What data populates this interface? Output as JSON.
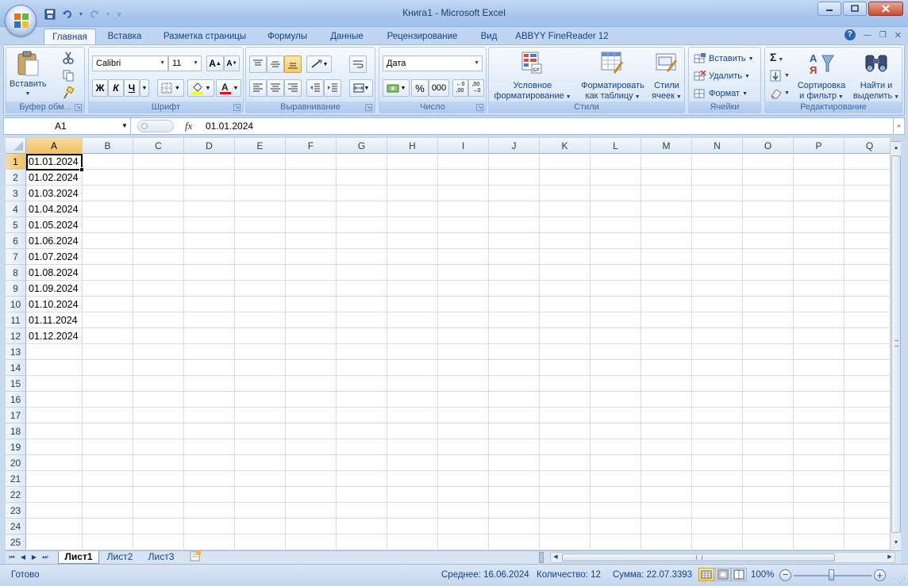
{
  "window": {
    "title": "Книга1 - Microsoft Excel"
  },
  "tabs": [
    "Главная",
    "Вставка",
    "Разметка страницы",
    "Формулы",
    "Данные",
    "Рецензирование",
    "Вид",
    "ABBYY FineReader 12"
  ],
  "ribbon": {
    "clipboard": {
      "paste": "Вставить",
      "label": "Буфер обм..."
    },
    "font": {
      "name": "Calibri",
      "size": "11",
      "bold": "Ж",
      "italic": "К",
      "underline": "Ч",
      "label": "Шрифт"
    },
    "alignment": {
      "label": "Выравнивание"
    },
    "number": {
      "format": "Дата",
      "percent": "%",
      "thousands": "000",
      "label": "Число"
    },
    "styles": {
      "conditional_1": "Условное",
      "conditional_2": "форматирование",
      "table_1": "Форматировать",
      "table_2": "как таблицу",
      "cell_1": "Стили",
      "cell_2": "ячеек",
      "label": "Стили"
    },
    "cells": {
      "insert": "Вставить",
      "delete": "Удалить",
      "format": "Формат",
      "label": "Ячейки"
    },
    "editing": {
      "sort_1": "Сортировка",
      "sort_2": "и фильтр",
      "find_1": "Найти и",
      "find_2": "выделить",
      "label": "Редактирование"
    }
  },
  "formula_bar": {
    "name_box": "A1",
    "fx": "fx",
    "value": "01.01.2024"
  },
  "columns": [
    "A",
    "B",
    "C",
    "D",
    "E",
    "F",
    "G",
    "H",
    "I",
    "J",
    "K",
    "L",
    "M",
    "N",
    "O",
    "P",
    "Q"
  ],
  "rows": [
    "1",
    "2",
    "3",
    "4",
    "5",
    "6",
    "7",
    "8",
    "9",
    "10",
    "11",
    "12",
    "13",
    "14",
    "15",
    "16",
    "17",
    "18",
    "19",
    "20",
    "21",
    "22",
    "23",
    "24",
    "25"
  ],
  "cells_a": [
    "01.01.2024",
    "01.02.2024",
    "01.03.2024",
    "01.04.2024",
    "01.05.2024",
    "01.06.2024",
    "01.07.2024",
    "01.08.2024",
    "01.09.2024",
    "01.10.2024",
    "01.11.2024",
    "01.12.2024"
  ],
  "sheets": [
    "Лист1",
    "Лист2",
    "Лист3"
  ],
  "status": {
    "ready": "Готово",
    "average": "Среднее: 16.06.2024",
    "count": "Количество: 12",
    "sum": "Сумма: 22.07.3393",
    "zoom": "100%"
  }
}
